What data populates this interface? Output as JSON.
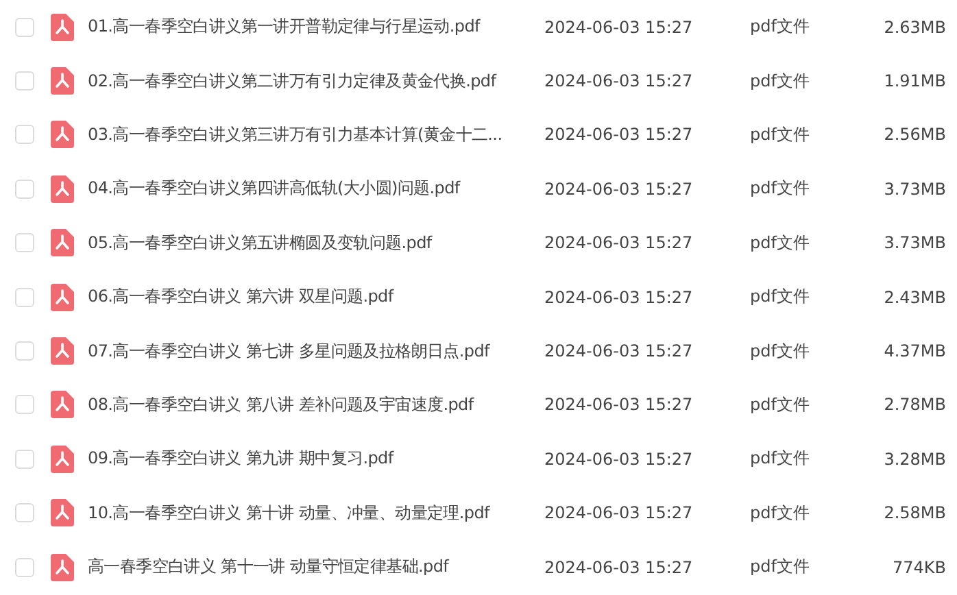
{
  "files": [
    {
      "checked": false,
      "name": "01.高一春季空白讲义第一讲开普勒定律与行星运动.pdf",
      "date": "2024-06-03 15:27",
      "type": "pdf文件",
      "size": "2.63MB"
    },
    {
      "checked": false,
      "name": "02.高一春季空白讲义第二讲万有引力定律及黄金代换.pdf",
      "date": "2024-06-03 15:27",
      "type": "pdf文件",
      "size": "1.91MB"
    },
    {
      "checked": false,
      "name": "03.高一春季空白讲义第三讲万有引力基本计算(黄金十二...",
      "date": "2024-06-03 15:27",
      "type": "pdf文件",
      "size": "2.56MB"
    },
    {
      "checked": false,
      "name": "04.高一春季空白讲义第四讲高低轨(大小圆)问题.pdf",
      "date": "2024-06-03 15:27",
      "type": "pdf文件",
      "size": "3.73MB"
    },
    {
      "checked": false,
      "name": "05.高一春季空白讲义第五讲椭圆及变轨问题.pdf",
      "date": "2024-06-03 15:27",
      "type": "pdf文件",
      "size": "3.73MB"
    },
    {
      "checked": false,
      "name": "06.高一春季空白讲义 第六讲 双星问题.pdf",
      "date": "2024-06-03 15:27",
      "type": "pdf文件",
      "size": "2.43MB"
    },
    {
      "checked": false,
      "name": "07.高一春季空白讲义 第七讲 多星问题及拉格朗日点.pdf",
      "date": "2024-06-03 15:27",
      "type": "pdf文件",
      "size": "4.37MB"
    },
    {
      "checked": false,
      "name": "08.高一春季空白讲义 第八讲 差补问题及宇宙速度.pdf",
      "date": "2024-06-03 15:27",
      "type": "pdf文件",
      "size": "2.78MB"
    },
    {
      "checked": false,
      "name": "09.高一春季空白讲义 第九讲 期中复习.pdf",
      "date": "2024-06-03 15:27",
      "type": "pdf文件",
      "size": "3.28MB"
    },
    {
      "checked": false,
      "name": "10.高一春季空白讲义 第十讲 动量、冲量、动量定理.pdf",
      "date": "2024-06-03 15:27",
      "type": "pdf文件",
      "size": "2.58MB"
    },
    {
      "checked": false,
      "name": "高一春季空白讲义 第十一讲 动量守恒定律基础.pdf",
      "date": "2024-06-03 15:27",
      "type": "pdf文件",
      "size": "774KB"
    }
  ]
}
